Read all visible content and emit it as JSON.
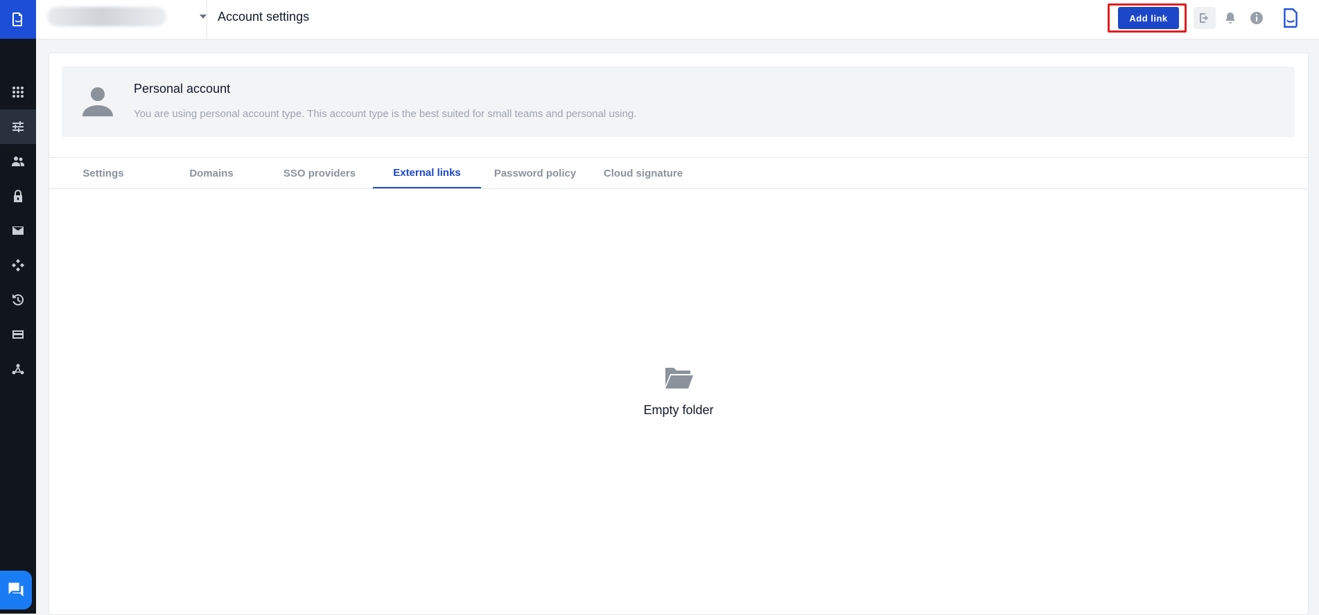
{
  "header": {
    "title": "Account settings",
    "add_link_label": "Add link"
  },
  "sidebar": {
    "items": [
      "apps-icon",
      "settings-sliders-icon",
      "users-icon",
      "lock-icon",
      "mail-icon",
      "integrations-icon",
      "history-icon",
      "billing-card-icon",
      "webhook-icon"
    ],
    "active_index": 1
  },
  "account": {
    "title": "Personal account",
    "description": "You are using personal account type. This account type is the best suited for small teams and personal using."
  },
  "tabs": [
    {
      "label": "Settings"
    },
    {
      "label": "Domains"
    },
    {
      "label": "SSO providers"
    },
    {
      "label": "External links"
    },
    {
      "label": "Password policy"
    },
    {
      "label": "Cloud signature"
    }
  ],
  "active_tab": "External links",
  "empty_state": {
    "label": "Empty folder"
  },
  "colors": {
    "accent": "#1d47c9",
    "rail": "#11151c",
    "highlight_frame": "#e11d1d"
  }
}
